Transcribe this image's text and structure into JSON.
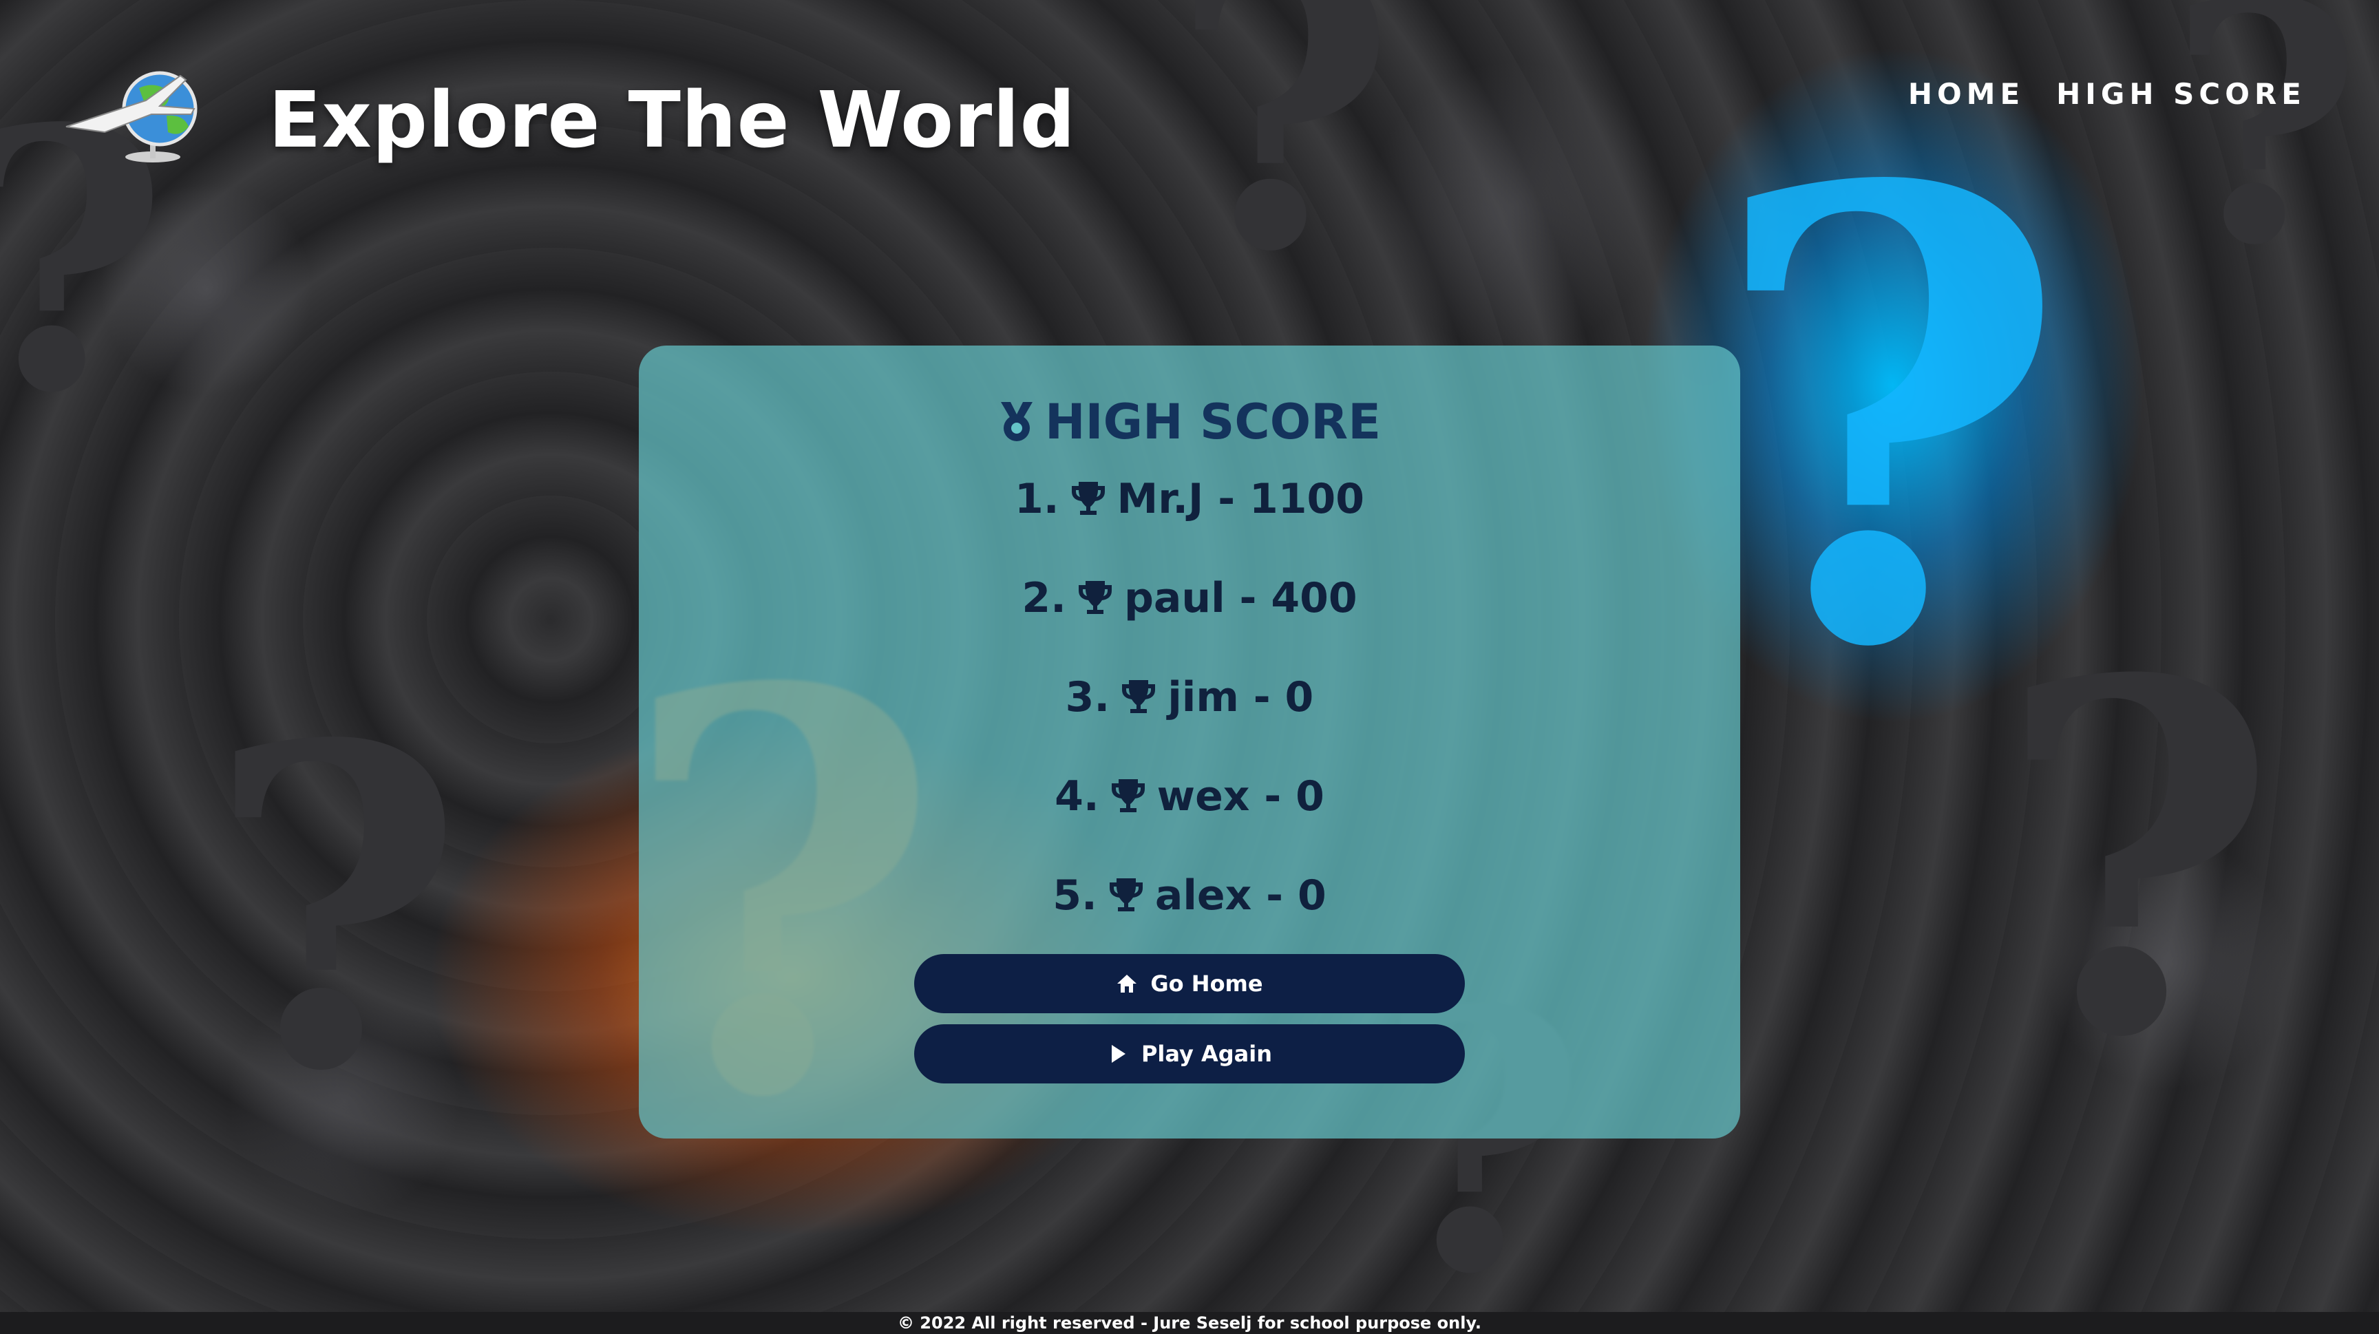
{
  "header": {
    "site_title": "Explore The World",
    "logo_icon": "globe-airplane-logo",
    "nav": [
      {
        "label": "HOME"
      },
      {
        "label": "HIGH SCORE"
      }
    ]
  },
  "card": {
    "title": "HIGH SCORE",
    "title_icon": "medal-icon",
    "scores": [
      {
        "rank": "1.",
        "text": "Mr.J - 1100"
      },
      {
        "rank": "2.",
        "text": "paul - 400"
      },
      {
        "rank": "3.",
        "text": "jim - 0"
      },
      {
        "rank": "4.",
        "text": "wex - 0"
      },
      {
        "rank": "5.",
        "text": "alex - 0"
      }
    ],
    "row_icon": "trophy-icon",
    "buttons": {
      "go_home": {
        "label": "Go Home",
        "icon": "home-icon"
      },
      "play_again": {
        "label": "Play Again",
        "icon": "play-icon"
      }
    }
  },
  "footer": {
    "text": "© 2022 All right reserved - Jure Seselj for school purpose only."
  },
  "colors": {
    "card_bg": "#64c4c8",
    "title_color": "#14335c",
    "button_bg": "#0d1f45",
    "accent_blue": "#00beff",
    "accent_orange": "#ff7814"
  }
}
